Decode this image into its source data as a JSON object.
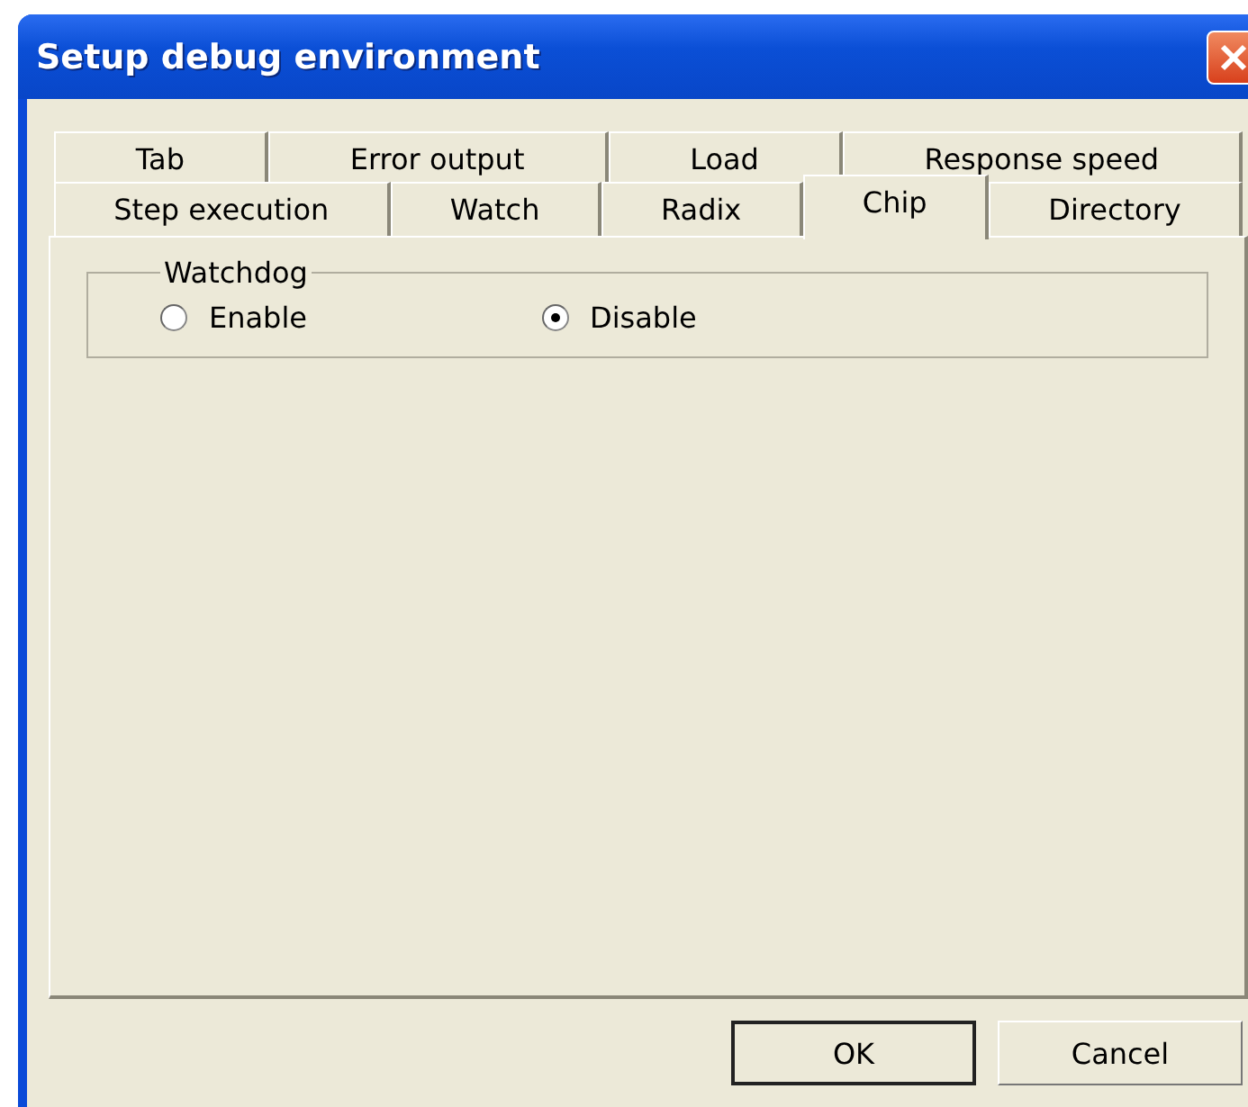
{
  "window": {
    "title": "Setup debug environment"
  },
  "tab_rows": [
    [
      {
        "label": "Tab",
        "selected": false
      },
      {
        "label": "Error output",
        "selected": false
      },
      {
        "label": "Load",
        "selected": false
      },
      {
        "label": "Response speed",
        "selected": false
      }
    ],
    [
      {
        "label": "Step execution",
        "selected": false
      },
      {
        "label": "Watch",
        "selected": false
      },
      {
        "label": "Radix",
        "selected": false
      },
      {
        "label": "Chip",
        "selected": true
      },
      {
        "label": "Directory",
        "selected": false
      }
    ]
  ],
  "watchdog": {
    "title": "Watchdog",
    "options": [
      {
        "label": "Enable",
        "selected": false
      },
      {
        "label": "Disable",
        "selected": true
      }
    ]
  },
  "buttons": [
    {
      "label": "OK",
      "default": true
    },
    {
      "label": "Cancel",
      "default": false
    }
  ]
}
